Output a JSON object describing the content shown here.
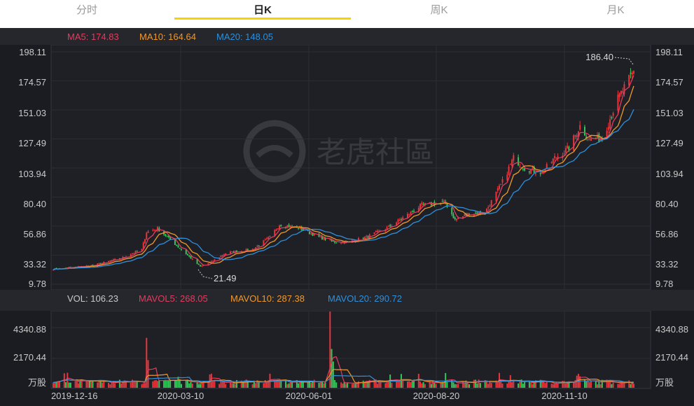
{
  "tabs": [
    {
      "label": "分时",
      "active": false
    },
    {
      "label": "日K",
      "active": true
    },
    {
      "label": "周K",
      "active": false
    },
    {
      "label": "月K",
      "active": false
    }
  ],
  "colors": {
    "up": "#e8373c",
    "down": "#35c85a",
    "ma5": "#e23c5e",
    "ma10": "#f0982a",
    "ma20": "#2f8fd9"
  },
  "price_panel": {
    "legend": [
      {
        "label": "MA5: 174.83",
        "color": "#e23c5e"
      },
      {
        "label": "MA10: 164.64",
        "color": "#f0982a"
      },
      {
        "label": "MA20: 148.05",
        "color": "#2f8fd9"
      }
    ],
    "y_ticks": [
      "198.11",
      "174.57",
      "151.03",
      "127.49",
      "103.94",
      "80.40",
      "56.86",
      "33.32",
      "9.78"
    ],
    "high_label": "186.40",
    "low_label": "21.49"
  },
  "volume_panel": {
    "legend": [
      {
        "label": "VOL: 106.23",
        "color": "#c9c9c9"
      },
      {
        "label": "MAVOL5: 268.05",
        "color": "#e23c5e"
      },
      {
        "label": "MAVOL10: 287.38",
        "color": "#f0982a"
      },
      {
        "label": "MAVOL20: 290.72",
        "color": "#2f8fd9"
      }
    ],
    "y_ticks": [
      "4340.88",
      "2170.44",
      "万股"
    ]
  },
  "x_ticks": [
    "2019-12-16",
    "2020-03-10",
    "2020-06-01",
    "2020-08-20",
    "2020-11-10"
  ],
  "watermark": "老虎社區",
  "chart_data": {
    "type": "candlestick",
    "price_ylim": [
      9.78,
      198.11
    ],
    "volume_ylim": [
      0,
      4340.88
    ],
    "price_anchors": [
      {
        "date": "2019-12-16",
        "close": 22
      },
      {
        "date": "2020-01-10",
        "close": 25
      },
      {
        "date": "2020-01-28",
        "close": 31
      },
      {
        "date": "2020-02-10",
        "close": 38
      },
      {
        "date": "2020-02-13",
        "close": 52
      },
      {
        "date": "2020-02-20",
        "close": 55
      },
      {
        "date": "2020-03-04",
        "close": 40
      },
      {
        "date": "2020-03-18",
        "close": 24
      },
      {
        "date": "2020-03-25",
        "close": 28
      },
      {
        "date": "2020-04-03",
        "close": 35
      },
      {
        "date": "2020-04-20",
        "close": 38
      },
      {
        "date": "2020-05-01",
        "close": 48
      },
      {
        "date": "2020-05-07",
        "close": 58
      },
      {
        "date": "2020-05-20",
        "close": 55
      },
      {
        "date": "2020-06-01",
        "close": 48
      },
      {
        "date": "2020-06-10",
        "close": 44
      },
      {
        "date": "2020-06-20",
        "close": 44
      },
      {
        "date": "2020-07-01",
        "close": 48
      },
      {
        "date": "2020-07-15",
        "close": 56
      },
      {
        "date": "2020-07-27",
        "close": 66
      },
      {
        "date": "2020-08-05",
        "close": 74
      },
      {
        "date": "2020-08-20",
        "close": 76
      },
      {
        "date": "2020-08-26",
        "close": 62
      },
      {
        "date": "2020-09-04",
        "close": 67
      },
      {
        "date": "2020-09-14",
        "close": 68
      },
      {
        "date": "2020-09-24",
        "close": 90
      },
      {
        "date": "2020-10-02",
        "close": 112
      },
      {
        "date": "2020-10-09",
        "close": 104
      },
      {
        "date": "2020-10-20",
        "close": 100
      },
      {
        "date": "2020-10-28",
        "close": 112
      },
      {
        "date": "2020-11-06",
        "close": 120
      },
      {
        "date": "2020-11-13",
        "close": 138
      },
      {
        "date": "2020-11-19",
        "close": 127
      },
      {
        "date": "2020-11-27",
        "close": 128
      },
      {
        "date": "2020-12-07",
        "close": 160
      },
      {
        "date": "2020-12-17",
        "close": 182
      }
    ],
    "volume_spikes": [
      {
        "date": "2020-02-13",
        "volume": 3600
      },
      {
        "date": "2020-02-14",
        "volume": 2000
      },
      {
        "date": "2020-06-08",
        "volume": 5500
      },
      {
        "date": "2020-06-09",
        "volume": 2800
      },
      {
        "date": "2020-06-10",
        "volume": 1900
      }
    ],
    "high": {
      "value": 186.4
    },
    "low": {
      "value": 21.49
    }
  }
}
